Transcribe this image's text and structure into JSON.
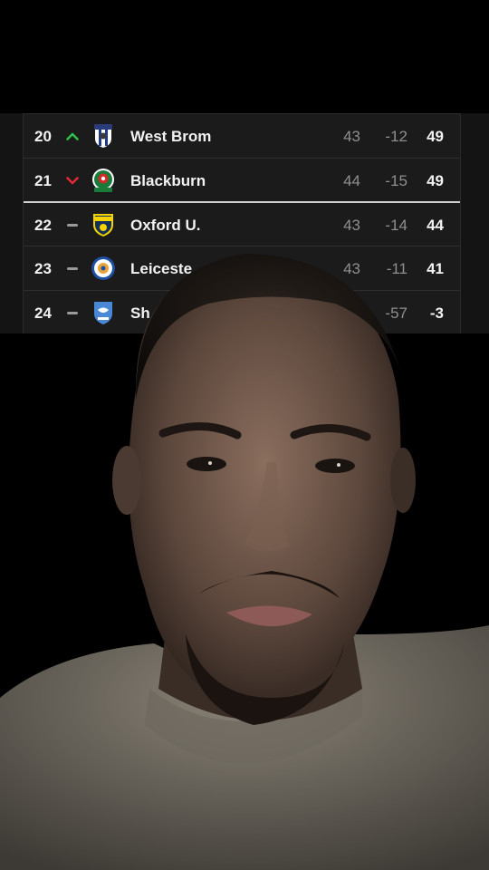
{
  "table": {
    "rows": [
      {
        "position": "20",
        "movement": "up",
        "team": "West Brom",
        "crest_icon": "west-brom-crest-icon",
        "played": "43",
        "goal_difference": "-12",
        "points": "49"
      },
      {
        "position": "21",
        "movement": "down",
        "team": "Blackburn",
        "crest_icon": "blackburn-crest-icon",
        "played": "44",
        "goal_difference": "-15",
        "points": "49"
      },
      {
        "position": "22",
        "movement": "same",
        "team": "Oxford U.",
        "crest_icon": "oxford-crest-icon",
        "played": "43",
        "goal_difference": "-14",
        "points": "44"
      },
      {
        "position": "23",
        "movement": "same",
        "team": "Leiceste",
        "crest_icon": "leicester-crest-icon",
        "played": "43",
        "goal_difference": "-11",
        "points": "41"
      },
      {
        "position": "24",
        "movement": "same",
        "team": "Sh",
        "crest_icon": "sheffield-wednesday-crest-icon",
        "played": "",
        "goal_difference": "-57",
        "points": "-3"
      }
    ],
    "colors": {
      "up": "#2fbf4a",
      "down": "#e0293a",
      "same": "#9a9a9a"
    }
  },
  "camera_overlay": {
    "subject_icon": "person-face-camera-icon"
  }
}
